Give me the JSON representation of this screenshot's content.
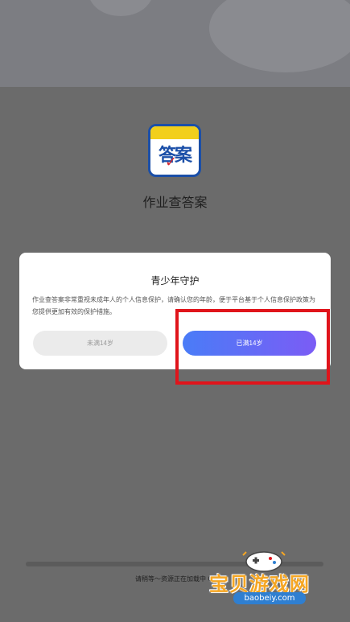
{
  "app": {
    "name": "作业查答案",
    "icon_glyphs": "答案",
    "icon_colors": {
      "border": "#1b4fa8",
      "band": "#f2cf1b",
      "check": "#d8262e"
    }
  },
  "dialog": {
    "title": "青少年守护",
    "body": "作业查答案非常重视未成年人的个人信息保护，请确认您的年龄，便于平台基于个人信息保护政策为您提供更加有效的保护措施。",
    "button_under": "未满14岁",
    "button_over": "已满14岁",
    "accent_gradient": [
      "#4a7cf7",
      "#7b5cf5"
    ]
  },
  "loading": {
    "text": "请稍等～资源正在加载中 0%",
    "progress": 0
  },
  "watermark": {
    "title": "宝贝游戏网",
    "url": "baobeiy.com"
  },
  "highlight": {
    "color": "#e0141b"
  }
}
